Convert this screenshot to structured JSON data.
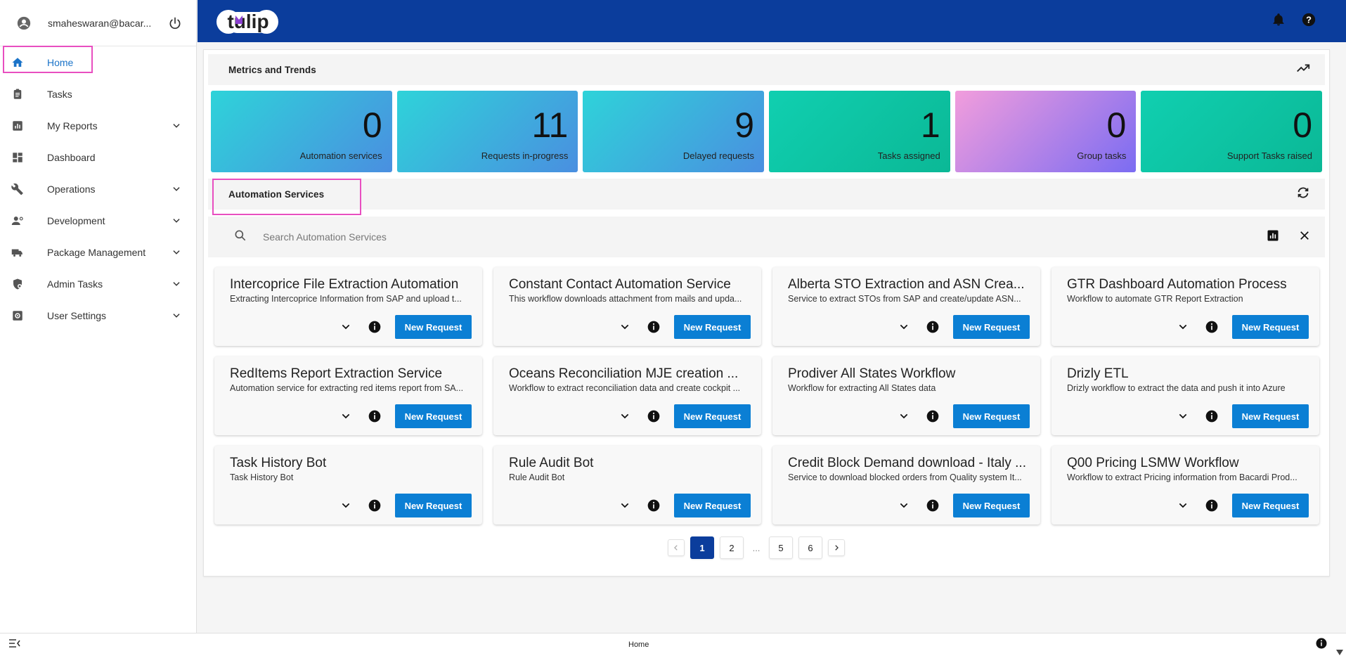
{
  "user": {
    "email": "smaheswaran@bacar..."
  },
  "sidebar": {
    "items": [
      {
        "label": "Home",
        "icon": "home-icon",
        "active": true,
        "expandable": false
      },
      {
        "label": "Tasks",
        "icon": "clipboard-icon",
        "expandable": false
      },
      {
        "label": "My Reports",
        "icon": "report-icon",
        "expandable": true
      },
      {
        "label": "Dashboard",
        "icon": "dashboard-icon",
        "expandable": false
      },
      {
        "label": "Operations",
        "icon": "wrench-icon",
        "expandable": true
      },
      {
        "label": "Development",
        "icon": "developer-icon",
        "expandable": true
      },
      {
        "label": "Package Management",
        "icon": "truck-icon",
        "expandable": true
      },
      {
        "label": "Admin Tasks",
        "icon": "admin-shield-icon",
        "expandable": true
      },
      {
        "label": "User Settings",
        "icon": "settings-box-icon",
        "expandable": true
      }
    ]
  },
  "header": {
    "logo_text": "tulip"
  },
  "metrics": {
    "title": "Metrics and Trends",
    "cards": [
      {
        "value": "0",
        "label": "Automation services"
      },
      {
        "value": "11",
        "label": "Requests in-progress"
      },
      {
        "value": "9",
        "label": "Delayed requests"
      },
      {
        "value": "1",
        "label": "Tasks assigned"
      },
      {
        "value": "0",
        "label": "Group tasks"
      },
      {
        "value": "0",
        "label": "Support Tasks raised"
      }
    ]
  },
  "services": {
    "title": "Automation Services",
    "search_placeholder": "Search Automation Services",
    "button_label": "New Request",
    "cards": [
      {
        "title": "Intercoprice File Extraction Automation",
        "desc": "Extracting Intercoprice Information from SAP and upload t..."
      },
      {
        "title": "Constant Contact Automation Service",
        "desc": "This workflow downloads attachment from mails and upda..."
      },
      {
        "title": "Alberta STO Extraction and ASN Crea...",
        "desc": "Service to extract STOs from SAP and create/update ASN..."
      },
      {
        "title": "GTR Dashboard Automation Process",
        "desc": "Workflow to automate GTR Report Extraction"
      },
      {
        "title": "RedItems Report Extraction Service",
        "desc": "Automation service for extracting red items report from SA..."
      },
      {
        "title": "Oceans Reconciliation MJE creation ...",
        "desc": "Workflow to extract reconciliation data and create cockpit ..."
      },
      {
        "title": "Prodiver All States Workflow",
        "desc": "Workflow for extracting All States data"
      },
      {
        "title": "Drizly ETL",
        "desc": "Drizly workflow to extract the data and push it into Azure"
      },
      {
        "title": "Task History Bot",
        "desc": "Task History Bot"
      },
      {
        "title": "Rule Audit Bot",
        "desc": "Rule Audit Bot"
      },
      {
        "title": "Credit Block Demand download - Italy ...",
        "desc": "Service to download blocked orders from Quality system It..."
      },
      {
        "title": "Q00 Pricing LSMW Workflow",
        "desc": "Workflow to extract Pricing information from Bacardi Prod..."
      }
    ]
  },
  "pagination": {
    "pages": [
      "1",
      "2",
      "...",
      "5",
      "6"
    ],
    "current": "1"
  },
  "footer": {
    "title": "Home"
  },
  "colors": {
    "topbar": "#0b3d9c",
    "accent": "#0b7fd4",
    "highlight": "#e84fc0",
    "active_nav": "#1a73c8"
  }
}
